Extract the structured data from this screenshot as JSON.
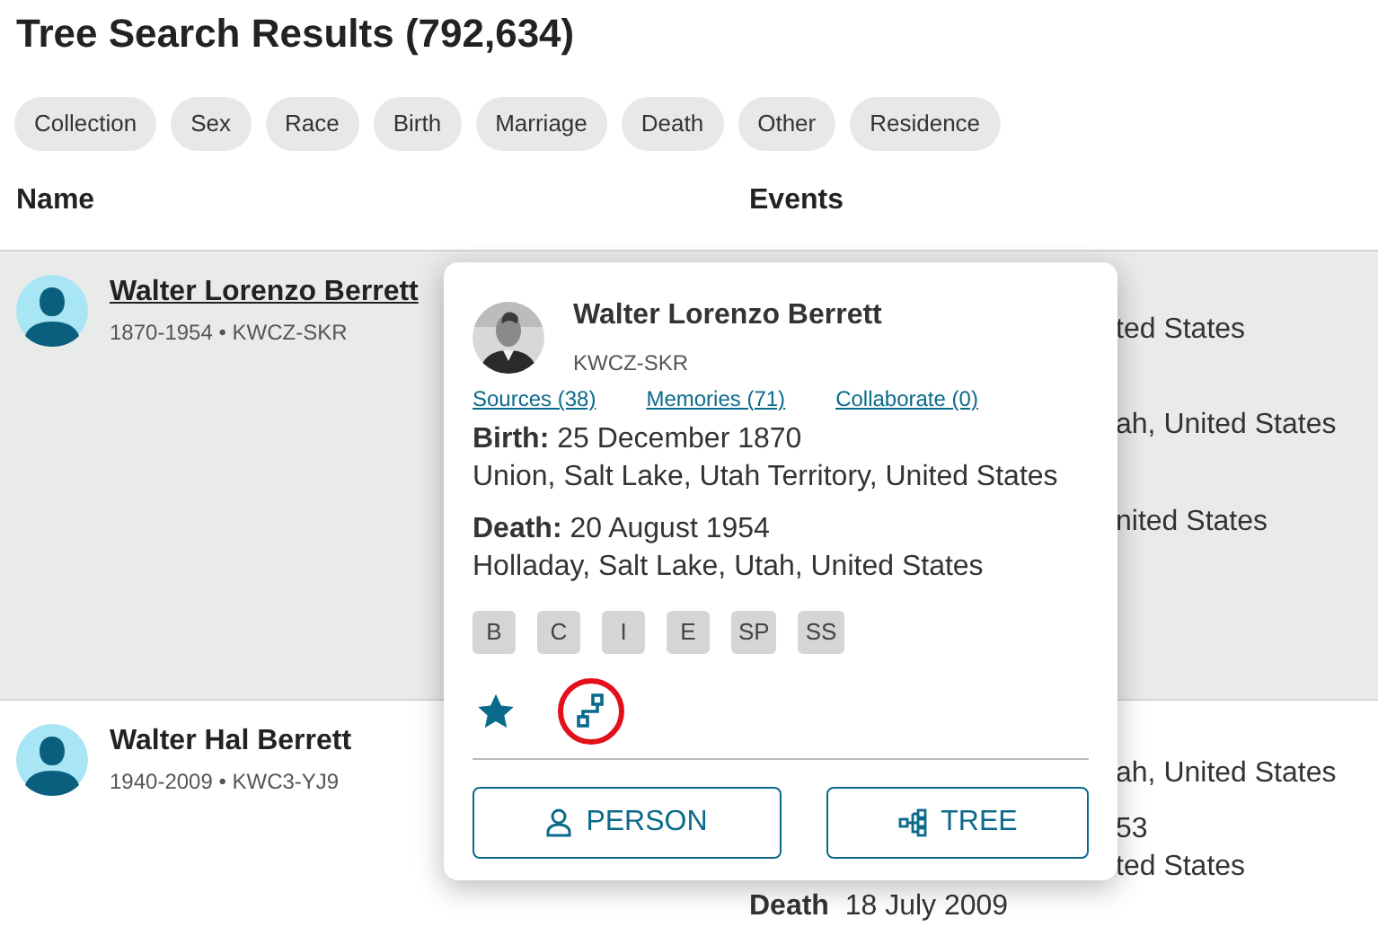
{
  "page": {
    "title": "Tree Search Results (792,634)"
  },
  "filters": [
    "Collection",
    "Sex",
    "Race",
    "Birth",
    "Marriage",
    "Death",
    "Other",
    "Residence"
  ],
  "columns": [
    "Name",
    "Events"
  ],
  "rows": [
    {
      "name": "Walter Lorenzo Berrett",
      "details": "1870-1954 • KWCZ-SKR",
      "highlighted": true,
      "events": [
        {
          "kind": "fragment",
          "text": "ted States"
        },
        {
          "kind": "fragment",
          "text": "ah, United States"
        },
        {
          "kind": "fragment",
          "text": "nited States"
        }
      ]
    },
    {
      "name": "Walter Hal Berrett",
      "details": "1940-2009 • KWC3-YJ9",
      "highlighted": false,
      "events": [
        {
          "kind": "fragment",
          "text": "ah, United States"
        },
        {
          "kind": "fragment",
          "text": "53"
        },
        {
          "kind": "fragment",
          "text": "ted States"
        },
        {
          "kind": "event",
          "label": "Death",
          "text": "18 July 2009"
        }
      ]
    }
  ],
  "popover": {
    "name": "Walter Lorenzo Berrett",
    "id": "KWCZ-SKR",
    "links": [
      "Sources (38)",
      "Memories (71)",
      "Collaborate (0)"
    ],
    "facts": [
      {
        "label": "Birth:",
        "date": "25 December 1870",
        "place": "Union, Salt Lake, Utah Territory, United States"
      },
      {
        "label": "Death:",
        "date": "20 August 1954",
        "place": "Holladay, Salt Lake, Utah, United States"
      }
    ],
    "tags": [
      "B",
      "C",
      "I",
      "E",
      "SP",
      "SS"
    ],
    "buttons": [
      {
        "kind": "person",
        "label": "PERSON"
      },
      {
        "kind": "tree",
        "label": "TREE"
      }
    ]
  }
}
